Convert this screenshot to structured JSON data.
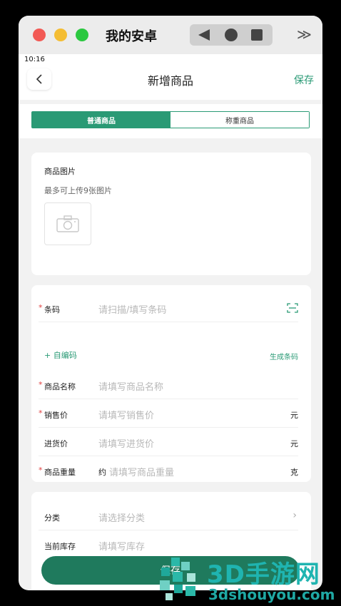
{
  "window": {
    "title": "我的安卓"
  },
  "status": {
    "time": "10:16"
  },
  "header": {
    "title": "新增商品",
    "save_label": "保存"
  },
  "tabs": [
    {
      "label": "普通商品"
    },
    {
      "label": "称重商品"
    }
  ],
  "images": {
    "label": "商品图片",
    "hint": "最多可上传9张图片"
  },
  "form": {
    "barcode": {
      "label": "条码",
      "placeholder": "请扫描/填写条码"
    },
    "auto_code": "+ 自编码",
    "gen_code": "生成条码",
    "name": {
      "label": "商品名称",
      "placeholder": "请填写商品名称"
    },
    "sale_price": {
      "label": "销售价",
      "placeholder": "请填写销售价",
      "unit": "元"
    },
    "cost_price": {
      "label": "进货价",
      "placeholder": "请填写进货价",
      "unit": "元"
    },
    "weight": {
      "label": "商品重量",
      "prefix": "约",
      "placeholder": "请填写商品重量",
      "unit": "克"
    },
    "required_mark": "*"
  },
  "extra": {
    "category": {
      "label": "分类",
      "placeholder": "请选择分类",
      "chevron": "›"
    },
    "stock": {
      "label": "当前库存",
      "placeholder": "请填写库存"
    }
  },
  "bottom": {
    "save_label": "保存"
  },
  "watermark": {
    "brand": "3D手游网",
    "url": "3dshouyou.com"
  },
  "colors": {
    "accent": "#2a9a75",
    "button": "#1f7a5d",
    "required": "#e04040"
  }
}
